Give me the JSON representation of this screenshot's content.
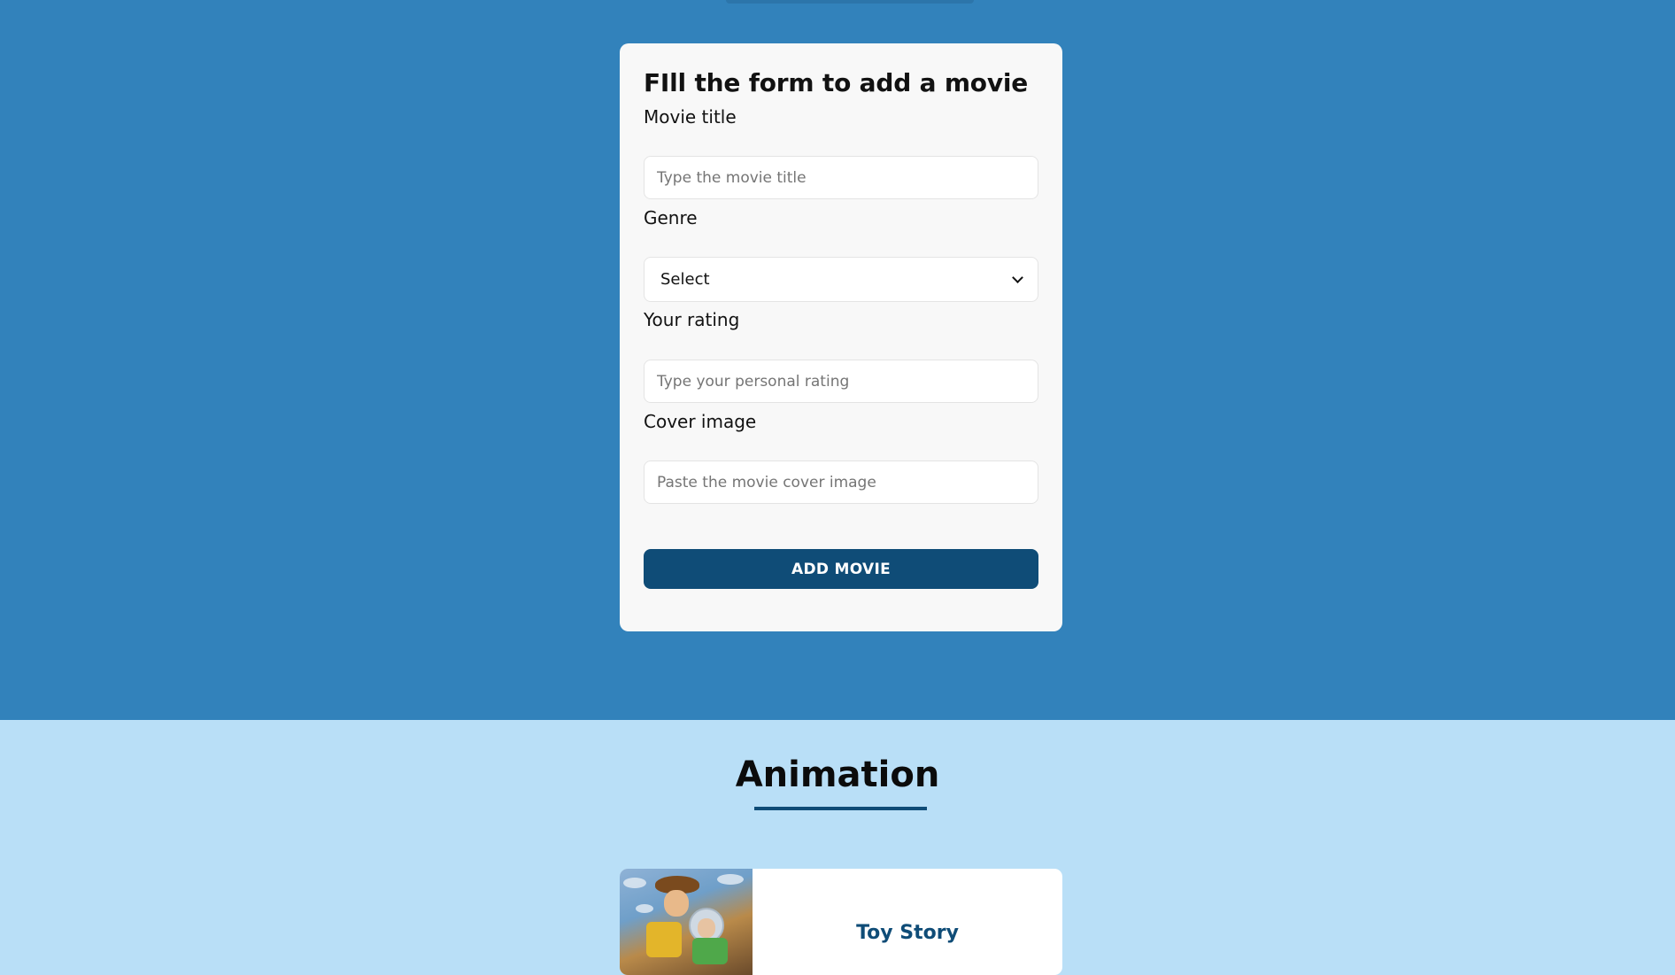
{
  "form": {
    "title": "FIll the form to add a movie",
    "movie_title_label": "Movie title",
    "movie_title_placeholder": "Type the movie title",
    "genre_label": "Genre",
    "genre_selected": "Select",
    "rating_label": "Your rating",
    "rating_placeholder": "Type your personal rating",
    "cover_label": "Cover image",
    "cover_placeholder": "Paste the movie cover image",
    "submit_label": "ADD MOVIE"
  },
  "section": {
    "heading": "Animation"
  },
  "movies": [
    {
      "title": "Toy Story",
      "cover_icon": "toy-story-cover-image"
    }
  ],
  "colors": {
    "top_background": "#3282bb",
    "bottom_background": "#b9dff7",
    "accent": "#0f4c77",
    "card": "#f8f8f8"
  }
}
